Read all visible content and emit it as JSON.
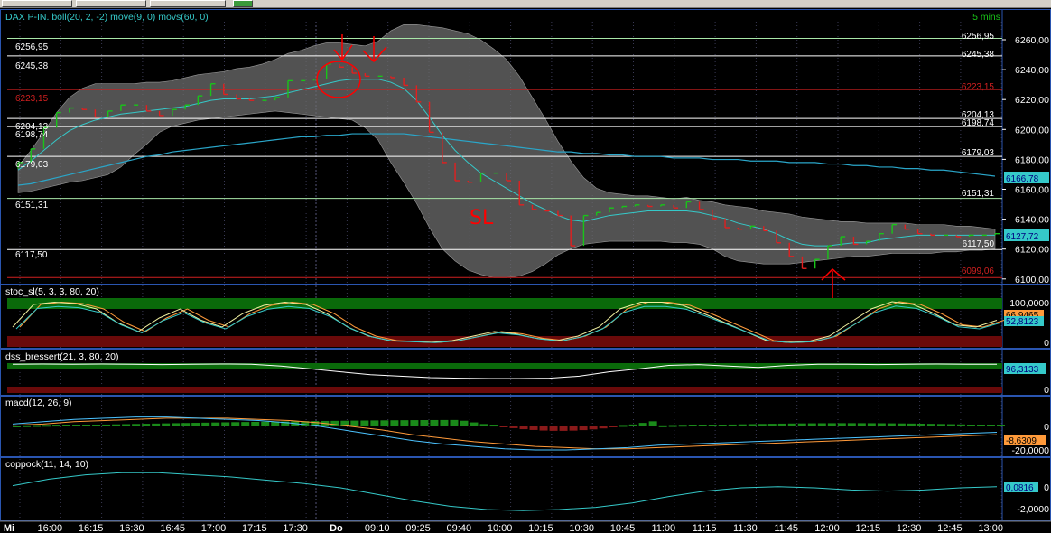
{
  "colors": {
    "background": "#000000",
    "panel_border": "#2a55b0",
    "grid_dotted": "#3a3a55",
    "up_bar": "#19c419",
    "down_bar": "#e21f1f",
    "fast_ma": "#35c9c9",
    "slow_ma": "#2aa6c9",
    "band_fill": "#6e6e6e",
    "hline_white": "#ffffff",
    "hline_red": "#d02020",
    "hline_green": "#a8e6a8",
    "stoch_k": "#f0f0a0",
    "stoch_d": "#ff9a3a",
    "macd": "#4cc3ff",
    "macd_signal": "#ff9a3a",
    "coppock": "#35c9c9",
    "overbought_zone": "#0a6a0a",
    "oversold_zone": "#6a0a0a",
    "annotation": "#ff0000"
  },
  "main": {
    "title": "DAX P-IN. boll(20, 2, -2) move(9, 0) movs(60, 0)",
    "timeframe": "5 mins",
    "price_axis": [
      "6260,00",
      "6240,00",
      "6220,00",
      "6200,00",
      "6180,00",
      "6160,00",
      "6140,00",
      "6120,00",
      "6100,00"
    ],
    "levels_left": [
      "6256,95",
      "6245,38",
      "6223,15",
      "6204,13",
      "6198,74",
      "6179,03",
      "6151,31",
      "6117,50"
    ],
    "levels_right": [
      "6256,95",
      "6245,38",
      "6223,15",
      "6204,13",
      "6198,74",
      "6179,03",
      "6151,31",
      "6117,50",
      "6099,06"
    ],
    "badges": [
      "6166,78",
      "6127,72"
    ],
    "annotation_text": "SL"
  },
  "panels": {
    "stoch": {
      "title": "stoc_sl(5, 3, 3, 80, 20)",
      "axis": [
        "100,0000",
        "0"
      ],
      "badges": [
        "66,9465",
        "52,8123"
      ]
    },
    "dss": {
      "title": "dss_bressert(21, 3, 80, 20)",
      "axis": [
        "0"
      ],
      "badges": [
        "96,3133"
      ]
    },
    "macd": {
      "title": "macd(12, 26, 9)",
      "axis": [
        "0",
        "-20,0000"
      ],
      "badges": [
        "-8,6309"
      ]
    },
    "coppock": {
      "title": "coppock(11, 14, 10)",
      "axis": [
        "0",
        "-2,0000"
      ],
      "badges": [
        "0,0816"
      ]
    }
  },
  "time_axis": [
    "Mi",
    "16:00",
    "16:15",
    "16:30",
    "16:45",
    "17:00",
    "17:15",
    "17:30",
    "Do",
    "09:10",
    "09:25",
    "09:40",
    "10:00",
    "10:15",
    "10:30",
    "10:45",
    "11:00",
    "11:15",
    "11:30",
    "11:45",
    "12:00",
    "12:15",
    "12:30",
    "12:45",
    "13:00"
  ],
  "chart_data": {
    "type": "line",
    "title": "DAX P-IN. boll(20, 2, -2) move(9, 0) movs(60, 0)",
    "xlabel": "",
    "ylabel": "",
    "ylim": [
      6095,
      6268
    ],
    "closes": [
      6175,
      6184,
      6198,
      6208,
      6211,
      6210,
      6205,
      6209,
      6213,
      6213,
      6209,
      6206,
      6210,
      6213,
      6219,
      6227,
      6220,
      6217,
      6216,
      6216,
      6218,
      6229,
      6229,
      6230,
      6240,
      6238,
      6234,
      6232,
      6232,
      6231,
      6226,
      6215,
      6195,
      6175,
      6163,
      6162,
      6168,
      6168,
      6163,
      6147,
      6144,
      6143,
      6140,
      6120,
      6140,
      6142,
      6145,
      6146,
      6147,
      6146,
      6147,
      6145,
      6149,
      6144,
      6138,
      6132,
      6131,
      6133,
      6130,
      6122,
      6113,
      6105,
      6111,
      6120,
      6126,
      6121,
      6123,
      6128,
      6134,
      6131,
      6128,
      6127,
      6127,
      6126,
      6127,
      6127,
      6128
    ],
    "bb_upper": [
      6172,
      6183,
      6195,
      6208,
      6218,
      6224,
      6227,
      6227,
      6227,
      6227,
      6228,
      6228,
      6229,
      6231,
      6233,
      6234,
      6235,
      6237,
      6238,
      6240,
      6243,
      6247,
      6249,
      6252,
      6254,
      6254,
      6253,
      6252,
      6255,
      6262,
      6266,
      6266,
      6265,
      6264,
      6262,
      6260,
      6256,
      6250,
      6243,
      6232,
      6218,
      6204,
      6189,
      6176,
      6165,
      6158,
      6155,
      6154,
      6153,
      6153,
      6152,
      6151,
      6152,
      6150,
      6149,
      6147,
      6146,
      6145,
      6143,
      6142,
      6141,
      6139,
      6138,
      6137,
      6136,
      6136,
      6135,
      6135,
      6135,
      6135,
      6134,
      6134,
      6134,
      6133,
      6133,
      6132,
      6131
    ],
    "bb_lower": [
      6155,
      6156,
      6158,
      6160,
      6162,
      6163,
      6165,
      6167,
      6172,
      6180,
      6187,
      6195,
      6199,
      6201,
      6203,
      6204,
      6205,
      6206,
      6207,
      6208,
      6209,
      6208,
      6207,
      6206,
      6205,
      6204,
      6203,
      6198,
      6190,
      6175,
      6162,
      6148,
      6132,
      6118,
      6110,
      6104,
      6101,
      6099,
      6099,
      6100,
      6103,
      6108,
      6114,
      6118,
      6121,
      6122,
      6123,
      6123,
      6123,
      6123,
      6123,
      6122,
      6122,
      6121,
      6118,
      6113,
      6110,
      6109,
      6108,
      6108,
      6108,
      6109,
      6110,
      6111,
      6112,
      6113,
      6113,
      6114,
      6115,
      6115,
      6115,
      6115,
      6116,
      6116,
      6117,
      6117,
      6118
    ],
    "ma_fast": [
      6170,
      6176,
      6183,
      6190,
      6196,
      6200,
      6203,
      6205,
      6207,
      6208,
      6209,
      6210,
      6211,
      6212,
      6214,
      6216,
      6217,
      6217,
      6217,
      6218,
      6219,
      6221,
      6223,
      6225,
      6227,
      6229,
      6230,
      6230,
      6230,
      6228,
      6224,
      6216,
      6205,
      6193,
      6183,
      6175,
      6168,
      6163,
      6158,
      6153,
      6148,
      6144,
      6140,
      6137,
      6136,
      6138,
      6140,
      6141,
      6142,
      6143,
      6143,
      6143,
      6143,
      6142,
      6140,
      6138,
      6135,
      6133,
      6131,
      6128,
      6124,
      6121,
      6120,
      6120,
      6121,
      6122,
      6122,
      6124,
      6125,
      6126,
      6127,
      6127,
      6127,
      6127,
      6127,
      6127,
      6127
    ],
    "ma_slow": [
      6160,
      6161,
      6163,
      6165,
      6167,
      6169,
      6171,
      6173,
      6175,
      6177,
      6179,
      6180,
      6182,
      6183,
      6184,
      6185,
      6186,
      6187,
      6188,
      6189,
      6190,
      6191,
      6192,
      6192,
      6193,
      6193,
      6194,
      6194,
      6194,
      6194,
      6194,
      6193,
      6192,
      6191,
      6190,
      6189,
      6188,
      6187,
      6186,
      6185,
      6184,
      6183,
      6182,
      6182,
      6181,
      6181,
      6180,
      6180,
      6179,
      6179,
      6179,
      6178,
      6178,
      6178,
      6177,
      6177,
      6177,
      6176,
      6176,
      6176,
      6175,
      6175,
      6175,
      6174,
      6174,
      6173,
      6173,
      6172,
      6172,
      6171,
      6171,
      6170,
      6170,
      6169,
      6168,
      6167,
      6166
    ]
  }
}
